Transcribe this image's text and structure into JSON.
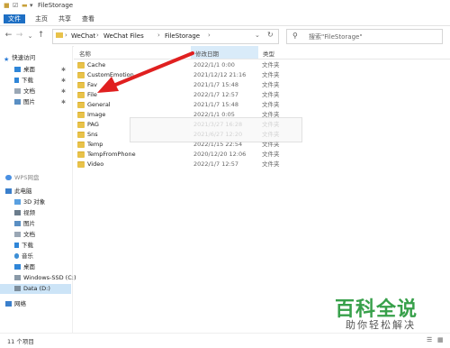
{
  "window": {
    "title": "FileStorage"
  },
  "ribbon": {
    "tabs": [
      "文件",
      "主页",
      "共享",
      "查看"
    ]
  },
  "address": {
    "crumbs": [
      "WeChat",
      "WeChat Files",
      "FileStorage"
    ]
  },
  "search": {
    "placeholder": "搜索\"FileStorage\""
  },
  "columns": {
    "name": "名称",
    "date": "修改日期",
    "type": "类型"
  },
  "nav": {
    "quick_access": "快速访问",
    "quick_items": [
      "桌面",
      "下载",
      "文档",
      "图片"
    ],
    "wp": "WPS网盘",
    "this_pc": "此电脑",
    "pc_items": [
      "3D 对象",
      "视频",
      "图片",
      "文档",
      "下载",
      "音乐",
      "桌面",
      "Windows-SSD (C:)",
      "Data (D:)"
    ],
    "network": "网络"
  },
  "files": [
    {
      "name": "Cache",
      "date": "2022/1/1 0:00",
      "type": "文件夹"
    },
    {
      "name": "CustomEmotion",
      "date": "2021/12/12 21:16",
      "type": "文件夹"
    },
    {
      "name": "Fav",
      "date": "2021/1/7 15:48",
      "type": "文件夹"
    },
    {
      "name": "File",
      "date": "2022/1/7 12:57",
      "type": "文件夹"
    },
    {
      "name": "General",
      "date": "2021/1/7 15:48",
      "type": "文件夹"
    },
    {
      "name": "Image",
      "date": "2022/1/1 0:05",
      "type": "文件夹"
    },
    {
      "name": "PAG",
      "date": "2021/3/27 16:28",
      "type": "文件夹"
    },
    {
      "name": "Sns",
      "date": "2021/6/27 12:20",
      "type": "文件夹"
    },
    {
      "name": "Temp",
      "date": "2022/1/15 22:54",
      "type": "文件夹"
    },
    {
      "name": "TempFromPhone",
      "date": "2020/12/20 12:06",
      "type": "文件夹"
    },
    {
      "name": "Video",
      "date": "2022/1/7 12:57",
      "type": "文件夹"
    }
  ],
  "status": {
    "count": "11 个项目"
  },
  "watermark": {
    "main": "百科全说",
    "sub": "助你轻松解决"
  },
  "colors": {
    "accent": "#1e6fc4",
    "folder": "#e8c24a",
    "arrow": "#e02020",
    "watermark": "#37a04a"
  }
}
